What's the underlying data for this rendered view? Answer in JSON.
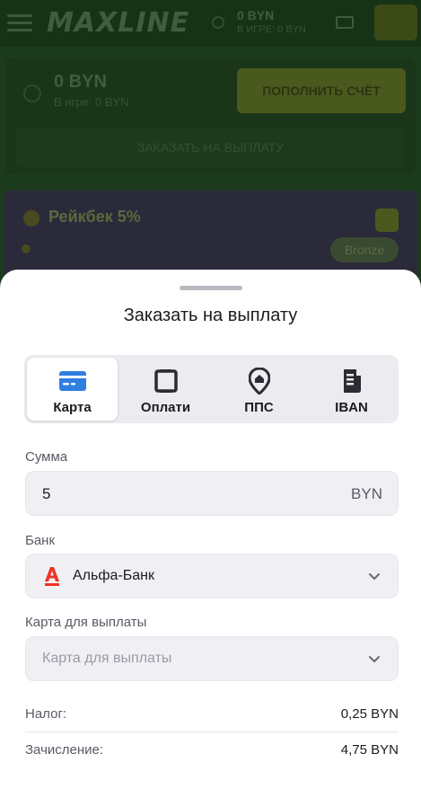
{
  "background": {
    "header": {
      "logo": "MAXLINE",
      "balance": "0 BYN",
      "games_balance": "В ИГРЕ: 0 BYN"
    },
    "balance_card": {
      "amount": "0 BYN",
      "in_games": "В игре: 0 BYN",
      "topup_label": "ПОПОЛНИТЬ СЧЁТ",
      "order_label": "ЗАКАЗАТЬ НА ВЫПЛАТУ"
    },
    "cashback": {
      "title": "Рейкбек 5%",
      "badge": "Bronze"
    }
  },
  "sheet": {
    "title": "Заказать на выплату",
    "tabs": [
      {
        "label": "Карта",
        "icon": "credit-card-icon",
        "active": true
      },
      {
        "label": "Оплати",
        "icon": "square-frame-icon",
        "active": false
      },
      {
        "label": "ППС",
        "icon": "location-house-icon",
        "active": false
      },
      {
        "label": "IBAN",
        "icon": "document-icon",
        "active": false
      }
    ],
    "amount": {
      "label": "Сумма",
      "value": "5",
      "currency": "BYN"
    },
    "bank": {
      "label": "Банк",
      "value": "Альфа-Банк",
      "icon": "alfa-bank-logo"
    },
    "card": {
      "label": "Карта для выплаты",
      "placeholder": "Карта для выплаты"
    },
    "summary": {
      "tax_label": "Налог:",
      "tax_value": "0,25 BYN",
      "credit_label": "Зачисление:",
      "credit_value": "4,75 BYN"
    }
  },
  "colors": {
    "accent_blue": "#2f7fe0",
    "alfa_red": "#ef3124",
    "sheet_bg": "#ffffff",
    "field_bg": "#f0f0f4"
  }
}
